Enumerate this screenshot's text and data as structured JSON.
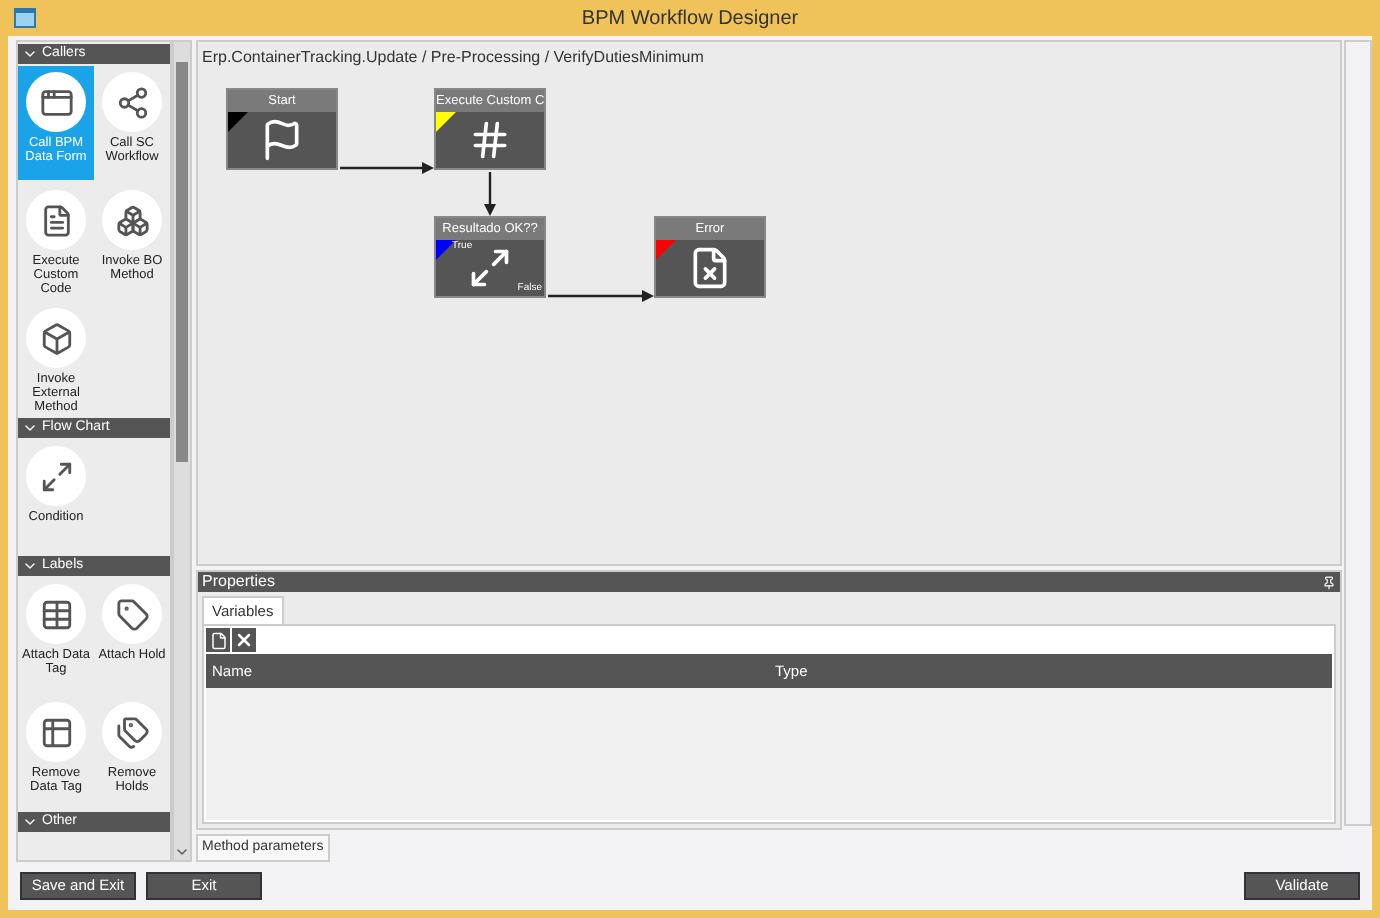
{
  "window": {
    "title": "BPM Workflow Designer"
  },
  "palette": {
    "sections": [
      {
        "title": "Callers",
        "expanded": true,
        "items": [
          {
            "label": "Call BPM Data Form",
            "selected": true
          },
          {
            "label": "Call SC Workflow",
            "selected": false
          },
          {
            "label": "Execute Custom Code",
            "selected": false
          },
          {
            "label": "Invoke BO Method",
            "selected": false
          },
          {
            "label": "Invoke External Method",
            "selected": false
          }
        ]
      },
      {
        "title": "Flow Chart",
        "expanded": true,
        "items": [
          {
            "label": "Condition",
            "selected": false
          }
        ]
      },
      {
        "title": "Labels",
        "expanded": true,
        "items": [
          {
            "label": "Attach Data Tag",
            "selected": false
          },
          {
            "label": "Attach Hold",
            "selected": false
          },
          {
            "label": "Remove Data Tag",
            "selected": false
          },
          {
            "label": "Remove Holds",
            "selected": false
          }
        ]
      },
      {
        "title": "Other",
        "expanded": true
      }
    ]
  },
  "breadcrumb": "Erp.ContainerTracking.Update / Pre-Processing / VerifyDutiesMinimum",
  "diagram": {
    "nodes": [
      {
        "title": "Start",
        "kind": "start",
        "color": "#000000"
      },
      {
        "title": "Execute Custom C",
        "kind": "code",
        "color": "#ffff00"
      },
      {
        "title": "Resultado OK??",
        "kind": "condition",
        "color": "#0000ff",
        "true_label": "True",
        "false_label": "False"
      },
      {
        "title": "Error",
        "kind": "error",
        "color": "#ff0000"
      }
    ]
  },
  "properties": {
    "title": "Properties",
    "tabs": [
      {
        "label": "Variables",
        "selected": true
      }
    ],
    "columns": [
      "Name",
      "Type"
    ]
  },
  "bottom_tabs": [
    {
      "label": "Method parameters",
      "selected": true
    }
  ],
  "buttons": {
    "left": [
      "Save and Exit",
      "Exit"
    ],
    "right": [
      "Validate"
    ]
  }
}
